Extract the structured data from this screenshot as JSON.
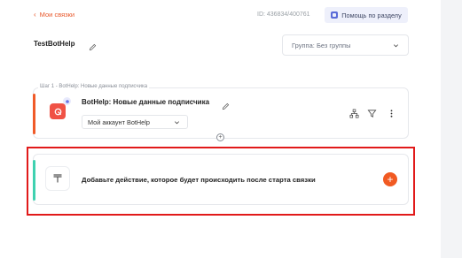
{
  "header": {
    "back_label": "Мои связки",
    "id_text": "ID: 436834/400761",
    "help_label": "Помощь по разделу"
  },
  "bot": {
    "title": "TestBotHelp",
    "group_label": "Группа: Без группы"
  },
  "steps": [
    {
      "step_label": "Шаг 1 - BotHelp: Новые данные подписчика",
      "title": "BotHelp: Новые данные подписчика",
      "account": "Мой аккаунт BotHelp"
    }
  ],
  "add_action": {
    "text": "Добавьте действие, которое будет происходить после старта связки"
  },
  "colors": {
    "accent_orange": "#f15a22",
    "accent_teal": "#3fd1b0",
    "highlight": "#e11a1a"
  },
  "icons": [
    "chevron-left-icon",
    "help-icon",
    "pencil-icon",
    "chevron-down-icon",
    "bothelp-app-icon",
    "network-icon",
    "filter-icon",
    "more-icon",
    "add-step-icon",
    "text-action-icon",
    "plus-icon"
  ]
}
